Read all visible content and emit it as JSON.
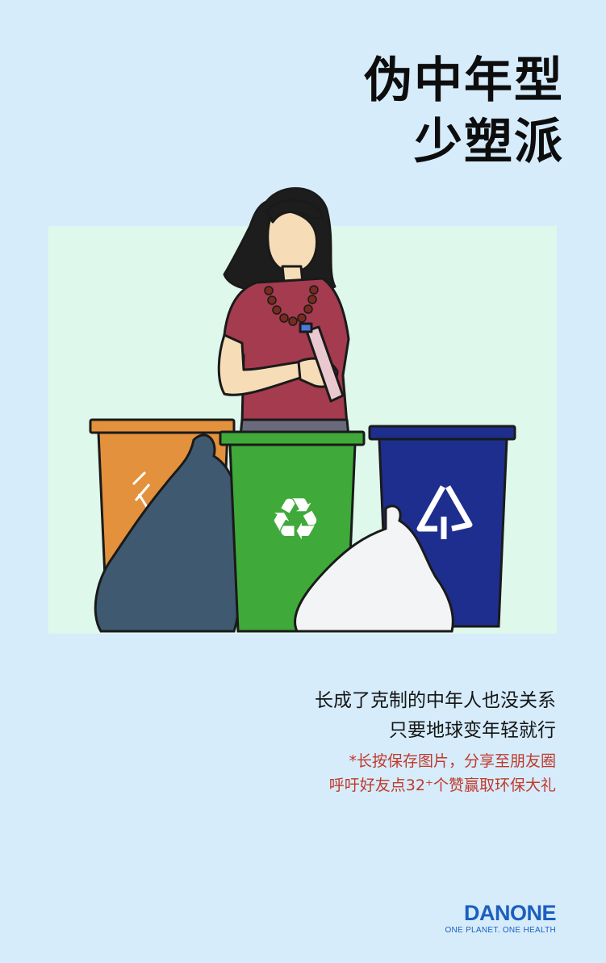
{
  "title": {
    "line1": "伪中年型",
    "line2": "少塑派"
  },
  "caption": {
    "line1": "长成了克制的中年人也没关系",
    "line2": "只要地球变年轻就行"
  },
  "note": {
    "line1": "*长按保存图片，分享至朋友圈",
    "line2": "呼吁好友点32⁺个赞赢取环保大礼"
  },
  "logo": {
    "wordmark": "DANONE",
    "tagline": "ONE PLANET. ONE HEALTH"
  },
  "colors": {
    "background": "#d6ecfb",
    "panel": "#dff8ec",
    "note": "#c0392b",
    "brand": "#1b5fbf",
    "bin_orange": "#e3913c",
    "bin_green": "#3fa93a",
    "bin_blue": "#1e2e8e"
  },
  "icons": [
    "recycle-icon",
    "recyclable-arrow-icon",
    "kitchen-waste-icon"
  ]
}
